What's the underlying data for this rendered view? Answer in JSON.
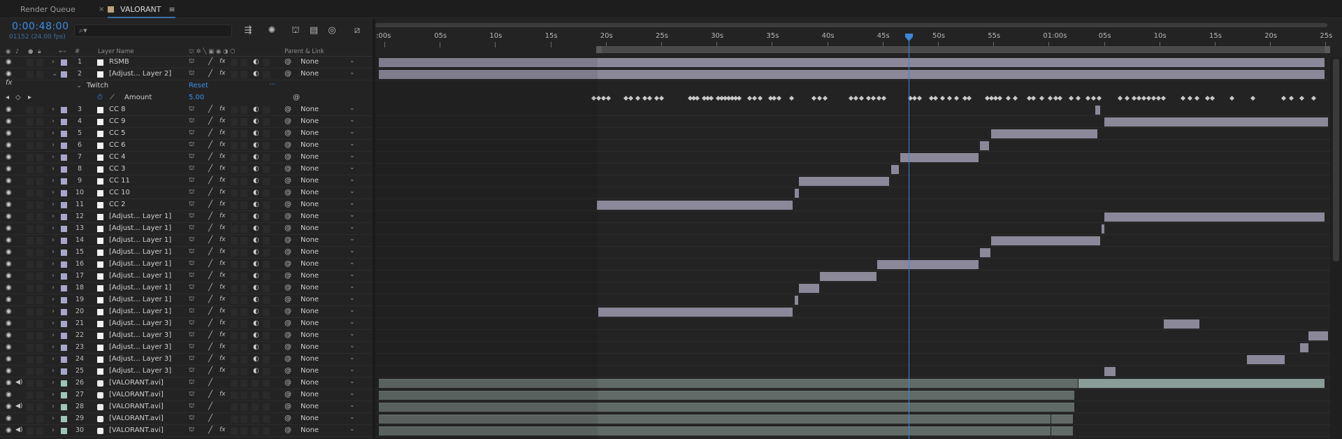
{
  "tabs": {
    "render_queue": "Render Queue",
    "comp": "VALORANT",
    "close": "×",
    "menu": "≡"
  },
  "header": {
    "timecode": "0:00:48:00",
    "fps": "01152 (24.00 fps)",
    "search_placeholder": ""
  },
  "columns": {
    "num": "#",
    "layer_name": "Layer Name",
    "parent": "Parent & Link"
  },
  "ruler_labels": [
    ":00s",
    "05s",
    "10s",
    "15s",
    "20s",
    "25s",
    "30s",
    "35s",
    "40s",
    "45s",
    "50s",
    "55s",
    "01:00s",
    "05s",
    "10s",
    "15s",
    "20s",
    "25s"
  ],
  "effect": {
    "fx": "fx",
    "name": "Twitch",
    "reset": "Reset",
    "dash": "...",
    "property": "Amount",
    "value": "5.00"
  },
  "parent_value": "None",
  "layers": [
    {
      "num": "1",
      "name": "RSMB",
      "label": "#a7a7c9",
      "type": "solid"
    },
    {
      "num": "2",
      "name": "[Adjust... Layer 2]",
      "label": "#a7a7c9",
      "type": "solid",
      "expanded": true
    },
    {
      "num": "3",
      "name": "CC 8",
      "label": "#a7a7c9",
      "type": "solid"
    },
    {
      "num": "4",
      "name": "CC 9",
      "label": "#a7a7c9",
      "type": "solid"
    },
    {
      "num": "5",
      "name": "CC 5",
      "label": "#a7a7c9",
      "type": "solid"
    },
    {
      "num": "6",
      "name": "CC 6",
      "label": "#a7a7c9",
      "type": "solid"
    },
    {
      "num": "7",
      "name": "CC 4",
      "label": "#a7a7c9",
      "type": "solid"
    },
    {
      "num": "8",
      "name": "CC 3",
      "label": "#a7a7c9",
      "type": "solid"
    },
    {
      "num": "9",
      "name": "CC 11",
      "label": "#a7a7c9",
      "type": "solid"
    },
    {
      "num": "10",
      "name": "CC 10",
      "label": "#a7a7c9",
      "type": "solid"
    },
    {
      "num": "11",
      "name": "CC 2",
      "label": "#a7a7c9",
      "type": "solid"
    },
    {
      "num": "12",
      "name": "[Adjust... Layer 1]",
      "label": "#a7a7c9",
      "type": "solid"
    },
    {
      "num": "13",
      "name": "[Adjust... Layer 1]",
      "label": "#a7a7c9",
      "type": "solid"
    },
    {
      "num": "14",
      "name": "[Adjust... Layer 1]",
      "label": "#a7a7c9",
      "type": "solid"
    },
    {
      "num": "15",
      "name": "[Adjust... Layer 1]",
      "label": "#a7a7c9",
      "type": "solid"
    },
    {
      "num": "16",
      "name": "[Adjust... Layer 1]",
      "label": "#a7a7c9",
      "type": "solid"
    },
    {
      "num": "17",
      "name": "[Adjust... Layer 1]",
      "label": "#a7a7c9",
      "type": "solid"
    },
    {
      "num": "18",
      "name": "[Adjust... Layer 1]",
      "label": "#a7a7c9",
      "type": "solid"
    },
    {
      "num": "19",
      "name": "[Adjust... Layer 1]",
      "label": "#a7a7c9",
      "type": "solid"
    },
    {
      "num": "20",
      "name": "[Adjust... Layer 1]",
      "label": "#a7a7c9",
      "type": "solid"
    },
    {
      "num": "21",
      "name": "[Adjust... Layer 3]",
      "label": "#a7a7c9",
      "type": "solid"
    },
    {
      "num": "22",
      "name": "[Adjust... Layer 3]",
      "label": "#a7a7c9",
      "type": "solid"
    },
    {
      "num": "23",
      "name": "[Adjust... Layer 3]",
      "label": "#a7a7c9",
      "type": "solid"
    },
    {
      "num": "24",
      "name": "[Adjust... Layer 3]",
      "label": "#a7a7c9",
      "type": "solid"
    },
    {
      "num": "25",
      "name": "[Adjust... Layer 3]",
      "label": "#a7a7c9",
      "type": "solid"
    },
    {
      "num": "26",
      "name": "[VALORANT.avi]",
      "label": "#9fc4b8",
      "type": "video",
      "audio": true
    },
    {
      "num": "27",
      "name": "[VALORANT.avi]",
      "label": "#9fc4b8",
      "type": "video",
      "audio": false
    },
    {
      "num": "28",
      "name": "[VALORANT.avi]",
      "label": "#9fc4b8",
      "type": "video",
      "audio": true
    },
    {
      "num": "29",
      "name": "[VALORANT.avi]",
      "label": "#9fc4b8",
      "type": "video",
      "audio": false
    },
    {
      "num": "30",
      "name": "[VALORANT.avi]",
      "label": "#9fc4b8",
      "type": "video",
      "audio": true
    }
  ],
  "colors": {
    "accent": "#3b8eea",
    "bar": "#8a8899",
    "video_bar": "#606a67"
  }
}
